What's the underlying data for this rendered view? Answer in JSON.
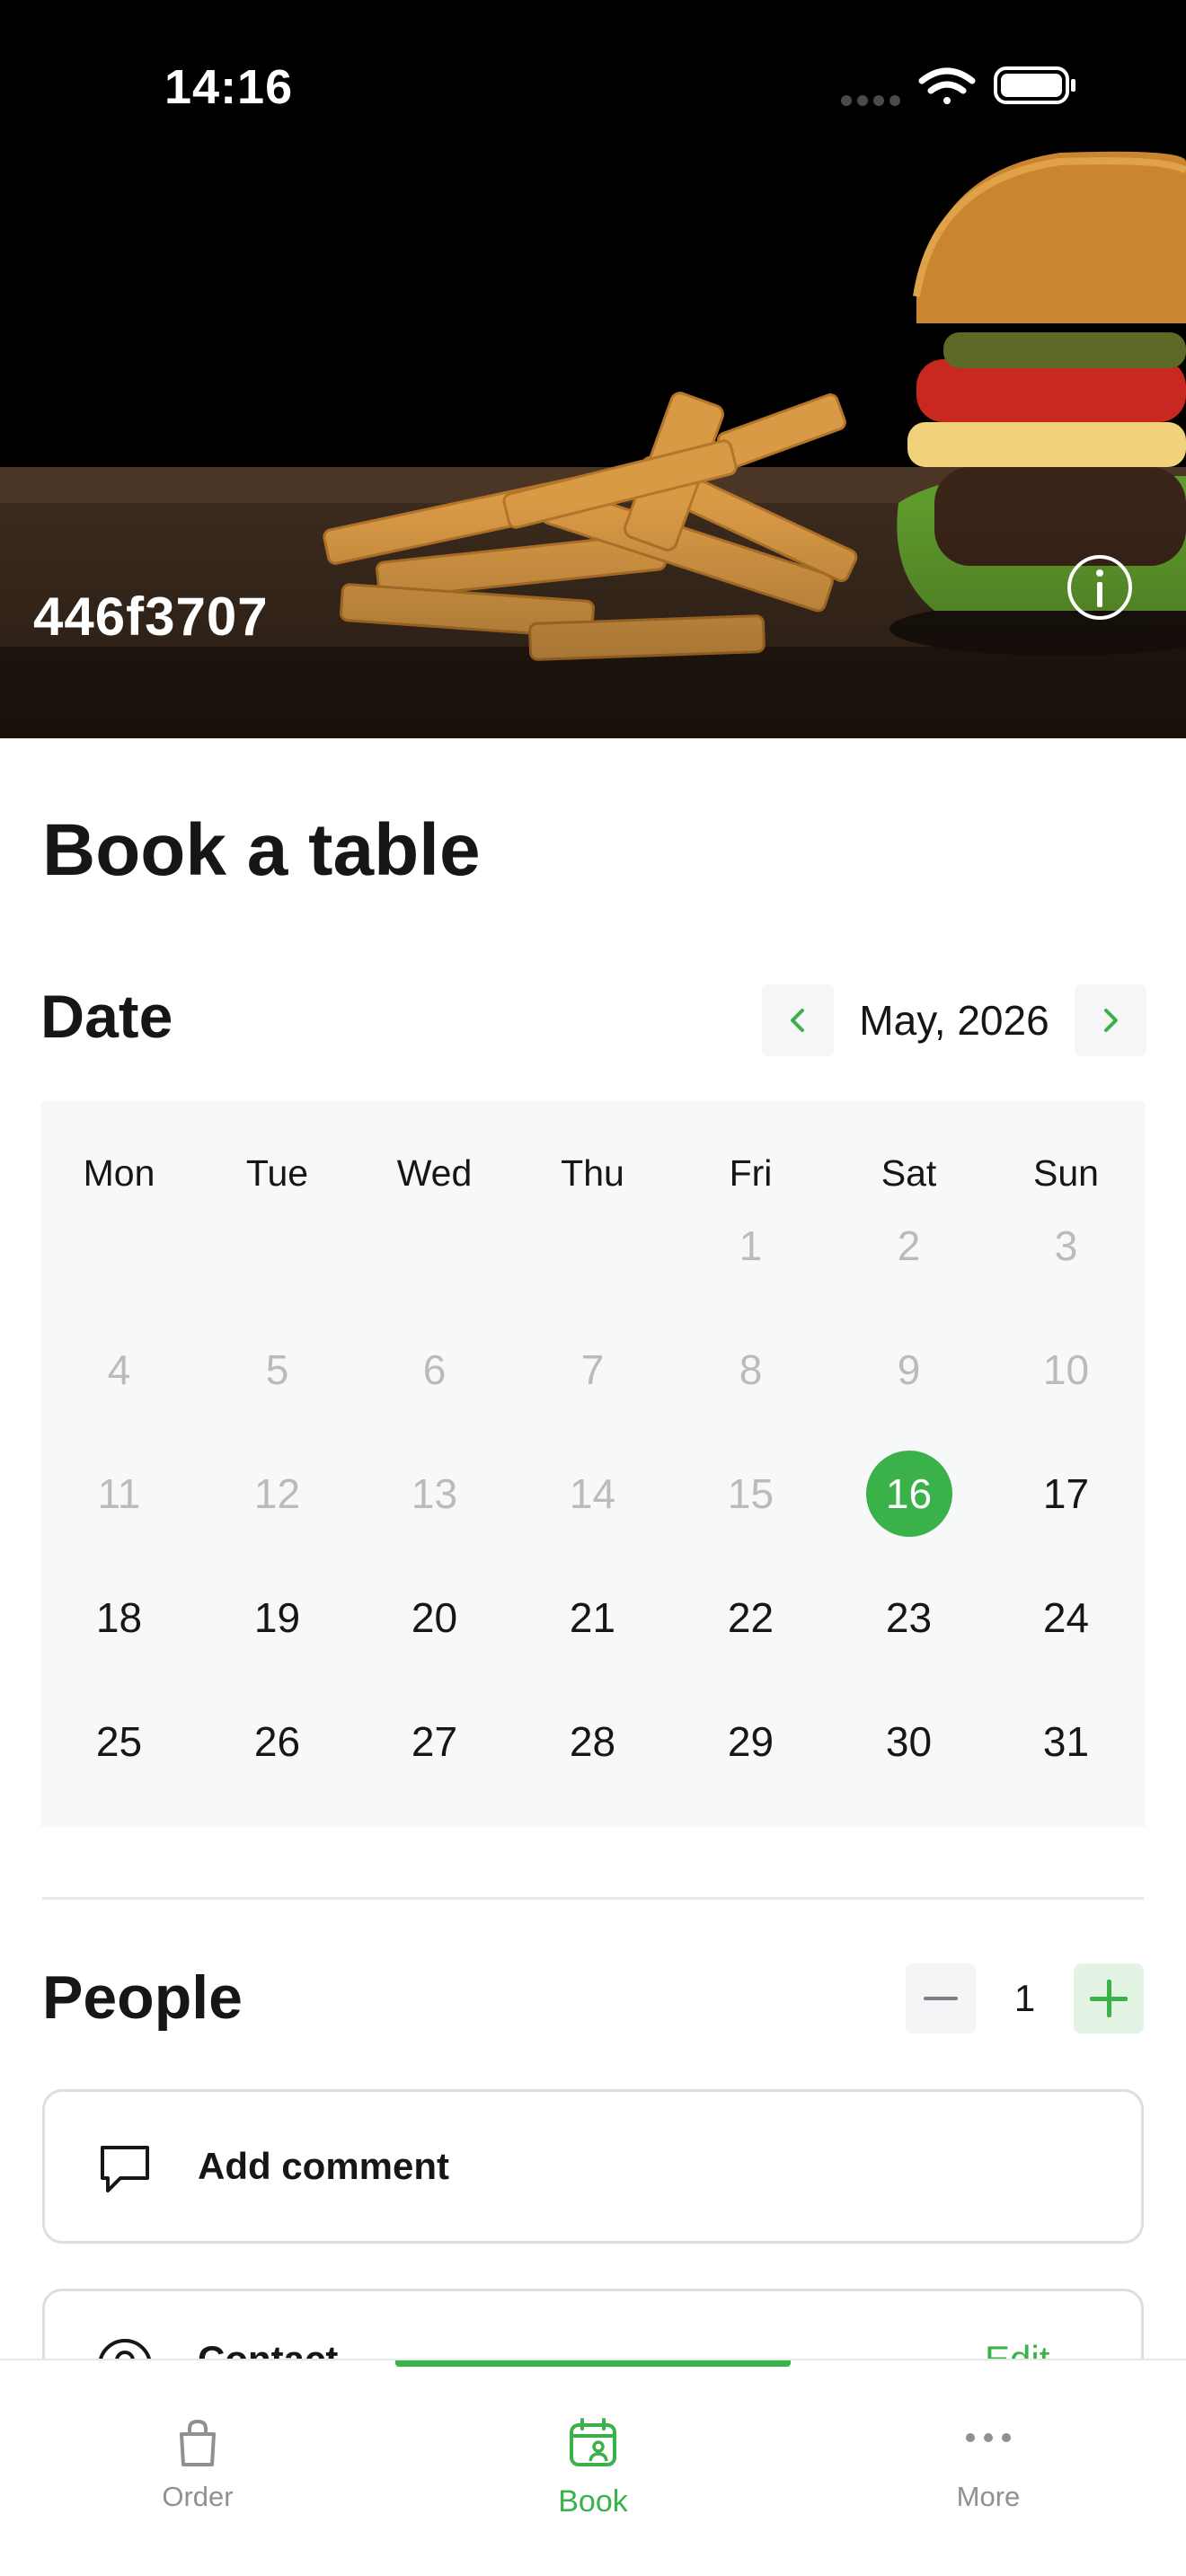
{
  "status_bar": {
    "time": "14:16"
  },
  "hero": {
    "venue_name": "446f3707",
    "info_icon": "info-icon"
  },
  "page": {
    "title": "Book a table"
  },
  "date_section": {
    "title": "Date",
    "month_label": "May, 2026",
    "prev_icon": "chevron-left-icon",
    "next_icon": "chevron-right-icon"
  },
  "calendar": {
    "weekdays": [
      "Mon",
      "Tue",
      "Wed",
      "Thu",
      "Fri",
      "Sat",
      "Sun"
    ],
    "first_weekday_index": 4,
    "days_in_month": 31,
    "selected_day": 16,
    "first_available_day": 16
  },
  "people_section": {
    "title": "People",
    "count": "1",
    "minus_icon": "minus-icon",
    "plus_icon": "plus-icon"
  },
  "comment": {
    "label": "Add comment",
    "icon": "comment-icon"
  },
  "contact": {
    "label": "Contact",
    "edit_label": "Edit",
    "icon": "person-icon"
  },
  "tabbar": {
    "tabs": [
      {
        "label": "Order",
        "icon": "bag-icon",
        "active": false
      },
      {
        "label": "Book",
        "icon": "calendar-person-icon",
        "active": true
      },
      {
        "label": "More",
        "icon": "more-dots-icon",
        "active": false
      }
    ]
  },
  "colors": {
    "accent": "#3bb14a",
    "text": "#161616",
    "muted": "#b9bbbd",
    "calendar_bg": "#f7f8f9"
  }
}
